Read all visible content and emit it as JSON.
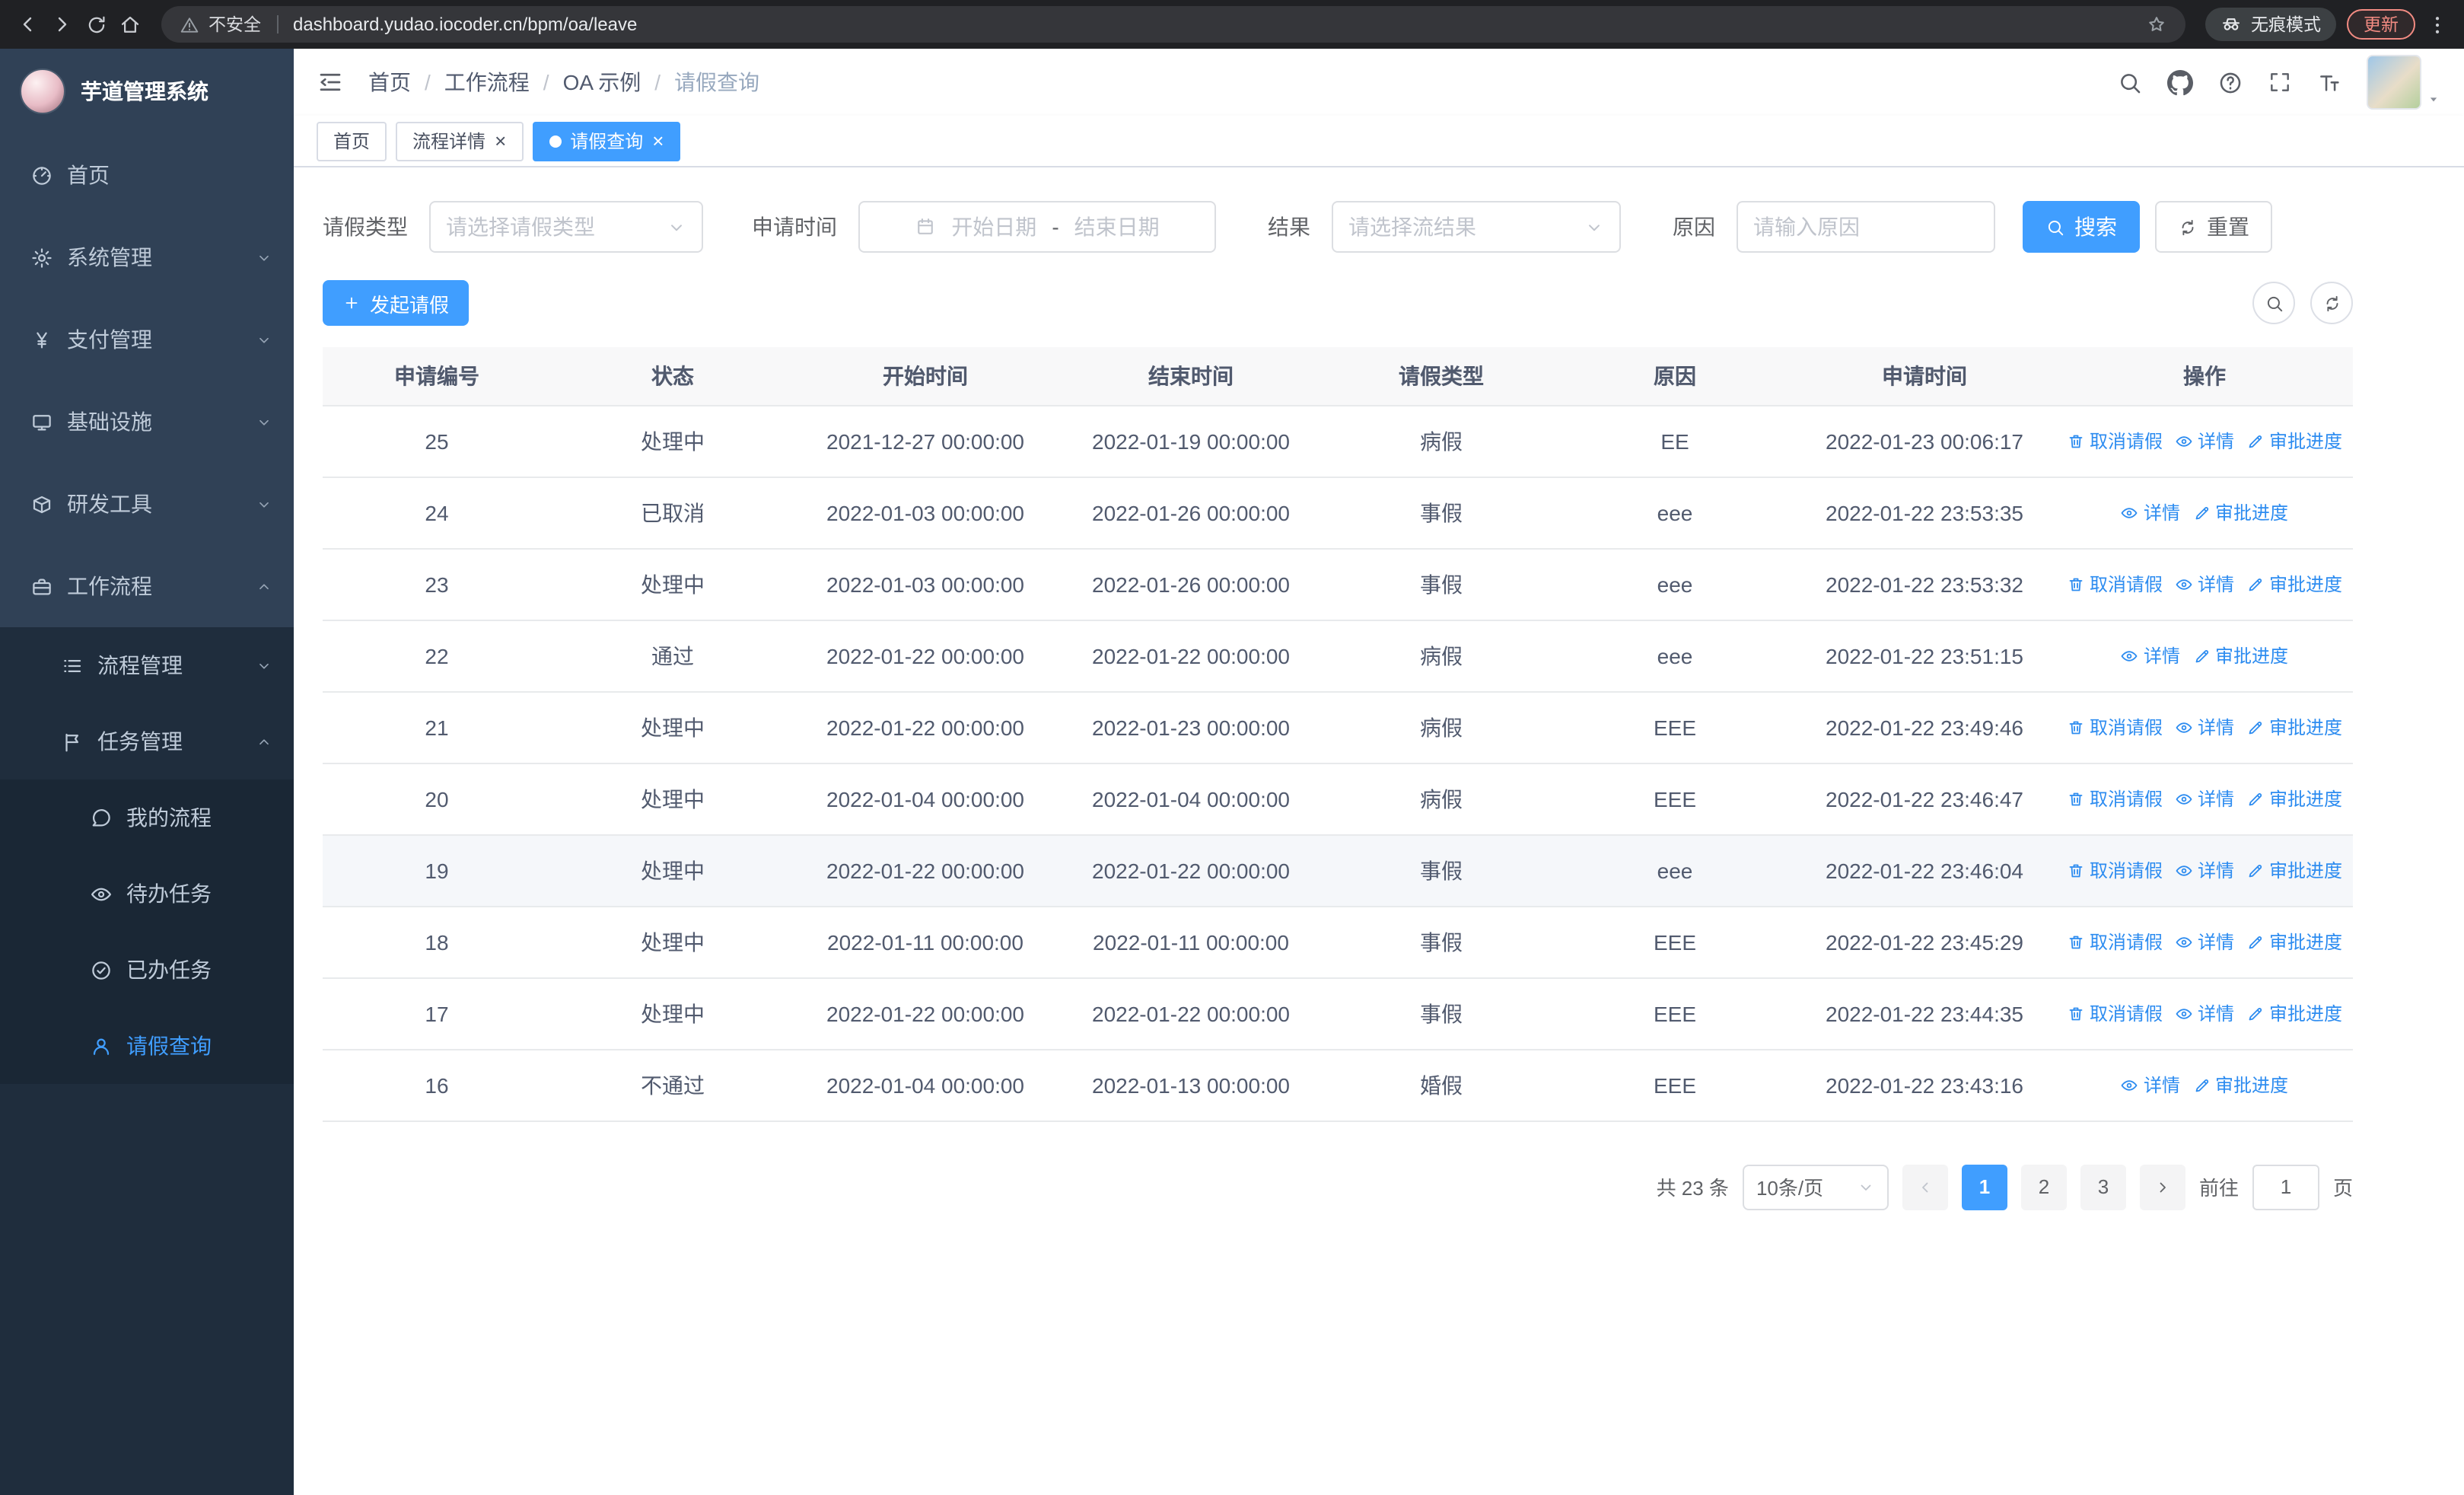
{
  "browser": {
    "security_label": "不安全",
    "url": "dashboard.yudao.iocoder.cn/bpm/oa/leave",
    "incognito_label": "无痕模式",
    "update_label": "更新"
  },
  "sidebar": {
    "logo_title": "芋道管理系统",
    "items": [
      {
        "key": "home",
        "label": "首页",
        "icon": "dashboard",
        "level": 1
      },
      {
        "key": "system",
        "label": "系统管理",
        "icon": "gear",
        "level": 1,
        "chevron": "down"
      },
      {
        "key": "payment",
        "label": "支付管理",
        "icon": "yen",
        "level": 1,
        "chevron": "down"
      },
      {
        "key": "infra",
        "label": "基础设施",
        "icon": "monitor",
        "level": 1,
        "chevron": "down"
      },
      {
        "key": "devtools",
        "label": "研发工具",
        "icon": "box",
        "level": 1,
        "chevron": "down"
      },
      {
        "key": "workflow",
        "label": "工作流程",
        "icon": "briefcase",
        "level": 1,
        "chevron": "up"
      },
      {
        "key": "process-mgmt",
        "label": "流程管理",
        "icon": "list",
        "level": 2,
        "chevron": "down"
      },
      {
        "key": "task-mgmt",
        "label": "任务管理",
        "icon": "flag",
        "level": 2,
        "chevron": "up"
      },
      {
        "key": "my-process",
        "label": "我的流程",
        "icon": "chat",
        "level": 3
      },
      {
        "key": "todo-tasks",
        "label": "待办任务",
        "icon": "eye",
        "level": 3
      },
      {
        "key": "done-tasks",
        "label": "已办任务",
        "icon": "check-circle",
        "level": 3
      },
      {
        "key": "leave-query",
        "label": "请假查询",
        "icon": "user",
        "level": 3,
        "active": true
      }
    ]
  },
  "header": {
    "breadcrumb": [
      "首页",
      "工作流程",
      "OA 示例",
      "请假查询"
    ]
  },
  "tabs": [
    {
      "key": "home",
      "label": "首页",
      "closable": false,
      "active": false
    },
    {
      "key": "process-detail",
      "label": "流程详情",
      "closable": true,
      "active": false
    },
    {
      "key": "leave-query",
      "label": "请假查询",
      "closable": true,
      "active": true
    }
  ],
  "filters": {
    "leave_type_label": "请假类型",
    "leave_type_placeholder": "请选择请假类型",
    "apply_time_label": "申请时间",
    "start_date_placeholder": "开始日期",
    "range_separator": "-",
    "end_date_placeholder": "结束日期",
    "result_label": "结果",
    "result_placeholder": "请选择流结果",
    "reason_label": "原因",
    "reason_placeholder": "请输入原因",
    "search_button": "搜索",
    "reset_button": "重置"
  },
  "toolbar": {
    "create_button": "发起请假"
  },
  "table": {
    "columns": [
      "申请编号",
      "状态",
      "开始时间",
      "结束时间",
      "请假类型",
      "原因",
      "申请时间",
      "操作"
    ],
    "action_labels": {
      "cancel": "取消请假",
      "detail": "详情",
      "progress": "审批进度"
    },
    "rows": [
      {
        "id": "25",
        "status": "处理中",
        "start": "2021-12-27 00:00:00",
        "end": "2022-01-19 00:00:00",
        "type": "病假",
        "reason": "EE",
        "applied": "2022-01-23 00:06:17",
        "actions": [
          "cancel",
          "detail",
          "progress"
        ]
      },
      {
        "id": "24",
        "status": "已取消",
        "start": "2022-01-03 00:00:00",
        "end": "2022-01-26 00:00:00",
        "type": "事假",
        "reason": "eee",
        "applied": "2022-01-22 23:53:35",
        "actions": [
          "detail",
          "progress"
        ]
      },
      {
        "id": "23",
        "status": "处理中",
        "start": "2022-01-03 00:00:00",
        "end": "2022-01-26 00:00:00",
        "type": "事假",
        "reason": "eee",
        "applied": "2022-01-22 23:53:32",
        "actions": [
          "cancel",
          "detail",
          "progress"
        ]
      },
      {
        "id": "22",
        "status": "通过",
        "start": "2022-01-22 00:00:00",
        "end": "2022-01-22 00:00:00",
        "type": "病假",
        "reason": "eee",
        "applied": "2022-01-22 23:51:15",
        "actions": [
          "detail",
          "progress"
        ]
      },
      {
        "id": "21",
        "status": "处理中",
        "start": "2022-01-22 00:00:00",
        "end": "2022-01-23 00:00:00",
        "type": "病假",
        "reason": "EEE",
        "applied": "2022-01-22 23:49:46",
        "actions": [
          "cancel",
          "detail",
          "progress"
        ]
      },
      {
        "id": "20",
        "status": "处理中",
        "start": "2022-01-04 00:00:00",
        "end": "2022-01-04 00:00:00",
        "type": "病假",
        "reason": "EEE",
        "applied": "2022-01-22 23:46:47",
        "actions": [
          "cancel",
          "detail",
          "progress"
        ]
      },
      {
        "id": "19",
        "status": "处理中",
        "start": "2022-01-22 00:00:00",
        "end": "2022-01-22 00:00:00",
        "type": "事假",
        "reason": "eee",
        "applied": "2022-01-22 23:46:04",
        "actions": [
          "cancel",
          "detail",
          "progress"
        ],
        "highlight": true
      },
      {
        "id": "18",
        "status": "处理中",
        "start": "2022-01-11 00:00:00",
        "end": "2022-01-11 00:00:00",
        "type": "事假",
        "reason": "EEE",
        "applied": "2022-01-22 23:45:29",
        "actions": [
          "cancel",
          "detail",
          "progress"
        ]
      },
      {
        "id": "17",
        "status": "处理中",
        "start": "2022-01-22 00:00:00",
        "end": "2022-01-22 00:00:00",
        "type": "事假",
        "reason": "EEE",
        "applied": "2022-01-22 23:44:35",
        "actions": [
          "cancel",
          "detail",
          "progress"
        ]
      },
      {
        "id": "16",
        "status": "不通过",
        "start": "2022-01-04 00:00:00",
        "end": "2022-01-13 00:00:00",
        "type": "婚假",
        "reason": "EEE",
        "applied": "2022-01-22 23:43:16",
        "actions": [
          "detail",
          "progress"
        ]
      }
    ]
  },
  "pagination": {
    "total_text": "共 23 条",
    "page_size": "10条/页",
    "pages": [
      "1",
      "2",
      "3"
    ],
    "active_page": "1",
    "goto_label": "前往",
    "goto_value": "1",
    "page_label": "页"
  },
  "colors": {
    "accent": "#409eff",
    "link_blue": "#2d8cf0",
    "sidebar_bg": "#304156",
    "sidebar_submenu_bg": "#1f2d3d",
    "sidebar_text": "#bfcbd9",
    "chrome_bg": "#202124",
    "update_badge": "#f28b82",
    "table_header_bg": "#f8f8f9"
  }
}
